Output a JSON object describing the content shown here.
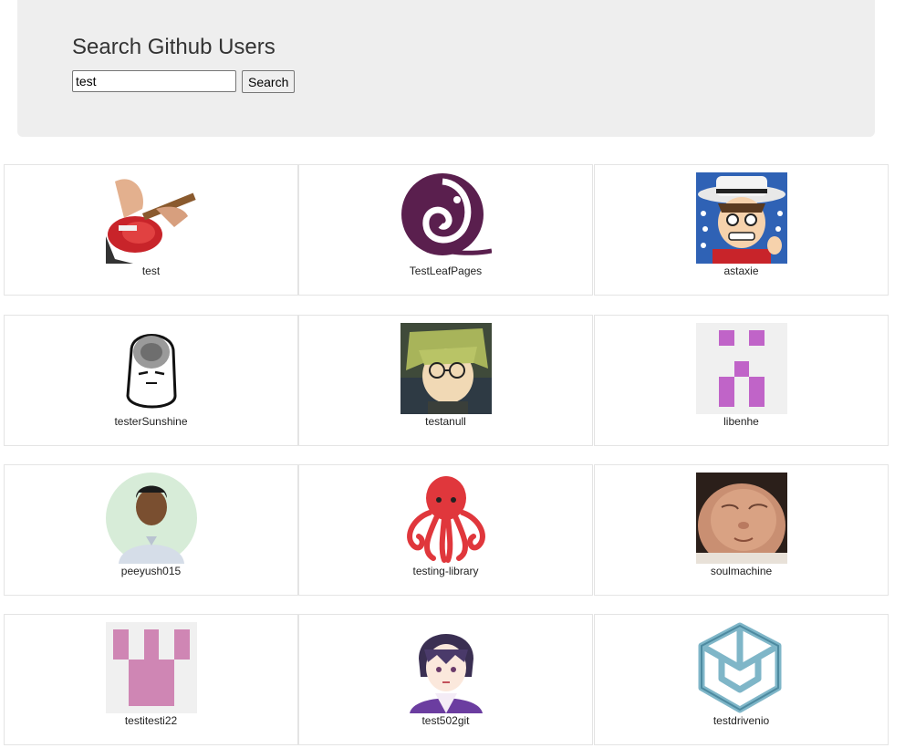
{
  "header": {
    "title": "Search Github Users",
    "search_value": "test",
    "search_button": "Search"
  },
  "users": [
    {
      "login": "test",
      "avatar": "guitar-player-avatar"
    },
    {
      "login": "TestLeafPages",
      "avatar": "purple-swirl-logo-avatar"
    },
    {
      "login": "astaxie",
      "avatar": "cartoon-hat-man-avatar"
    },
    {
      "login": "testerSunshine",
      "avatar": "meme-face-avatar"
    },
    {
      "login": "testanull",
      "avatar": "anime-glasses-boy-avatar"
    },
    {
      "login": "libenhe",
      "avatar": "purple-identicon-avatar"
    },
    {
      "login": "peeyush015",
      "avatar": "man-portrait-avatar"
    },
    {
      "login": "testing-library",
      "avatar": "red-octopus-avatar"
    },
    {
      "login": "soulmachine",
      "avatar": "baby-face-avatar"
    },
    {
      "login": "testitesti22",
      "avatar": "pink-identicon-avatar"
    },
    {
      "login": "test502git",
      "avatar": "anime-purple-hair-avatar"
    },
    {
      "login": "testdrivenio",
      "avatar": "blue-cube-logo-avatar"
    }
  ]
}
